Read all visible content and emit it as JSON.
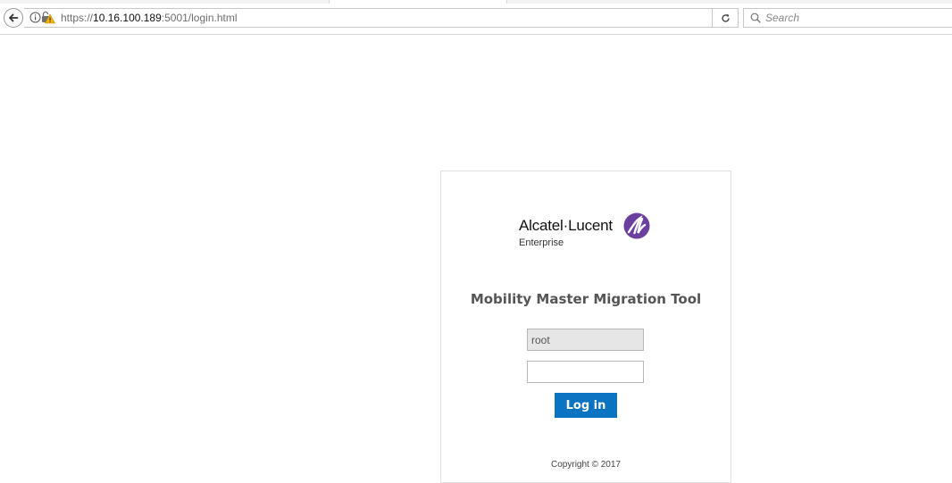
{
  "browser": {
    "url_scheme": "https://",
    "url_host": "10.16.100.189",
    "url_rest": ":5001/login.html",
    "search_placeholder": "Search",
    "icons": {
      "back": "back-arrow-icon",
      "info": "info-icon",
      "security": "broken-lock-warning-icon",
      "reload": "reload-icon",
      "search": "search-icon"
    }
  },
  "login": {
    "logo_text_left": "Alcatel",
    "logo_dot": "·",
    "logo_text_right": "Lucent",
    "logo_sub": "Enterprise",
    "title": "Mobility Master Migration Tool",
    "username_value": "root",
    "password_value": "",
    "login_label": "Log in",
    "copyright": "Copyright © 2017",
    "colors": {
      "button": "#0a73c2",
      "logo_mark": "#6b3fa0",
      "title": "#555555"
    }
  }
}
